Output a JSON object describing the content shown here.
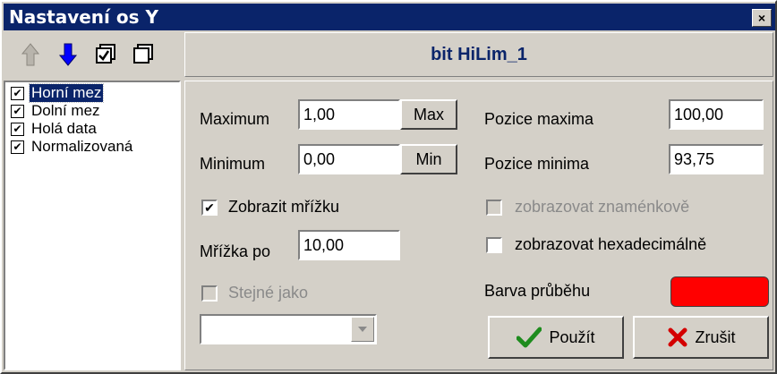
{
  "window": {
    "title": "Nastavení os Y",
    "close_glyph": "×"
  },
  "toolbar": {
    "icons": [
      "arrow-up-icon",
      "arrow-down-icon",
      "check-all-icon",
      "uncheck-all-icon"
    ]
  },
  "series_list": {
    "items": [
      {
        "label": "Horní mez",
        "checked": true,
        "selected": true
      },
      {
        "label": "Dolní mez",
        "checked": true,
        "selected": false
      },
      {
        "label": "Holá data",
        "checked": true,
        "selected": false
      },
      {
        "label": "Normalizovaná",
        "checked": true,
        "selected": false
      }
    ],
    "check_glyph": "✔"
  },
  "header": {
    "title": "bit HiLim_1"
  },
  "form": {
    "maximum_label": "Maximum",
    "maximum_value": "1,00",
    "max_button": "Max",
    "minimum_label": "Minimum",
    "minimum_value": "0,00",
    "min_button": "Min",
    "grid_checkbox_label": "Zobrazit mřížku",
    "grid_step_label": "Mřížka po",
    "grid_step_value": "10,00",
    "same_as_label": "Stejné jako",
    "same_as_value": "",
    "pos_max_label": "Pozice maxima",
    "pos_max_value": "100,00",
    "pos_min_label": "Pozice minima",
    "pos_min_value": "93,75",
    "signed_label": "zobrazovat znaménkově",
    "hex_label": "zobrazovat hexadecimálně",
    "color_label": "Barva průběhu",
    "check_glyph": "✔"
  },
  "buttons": {
    "apply": "Použít",
    "cancel": "Zrušit"
  },
  "colors": {
    "title_bar": "#0a246a",
    "series_color": "#ff0000",
    "face": "#d4d0c8"
  }
}
